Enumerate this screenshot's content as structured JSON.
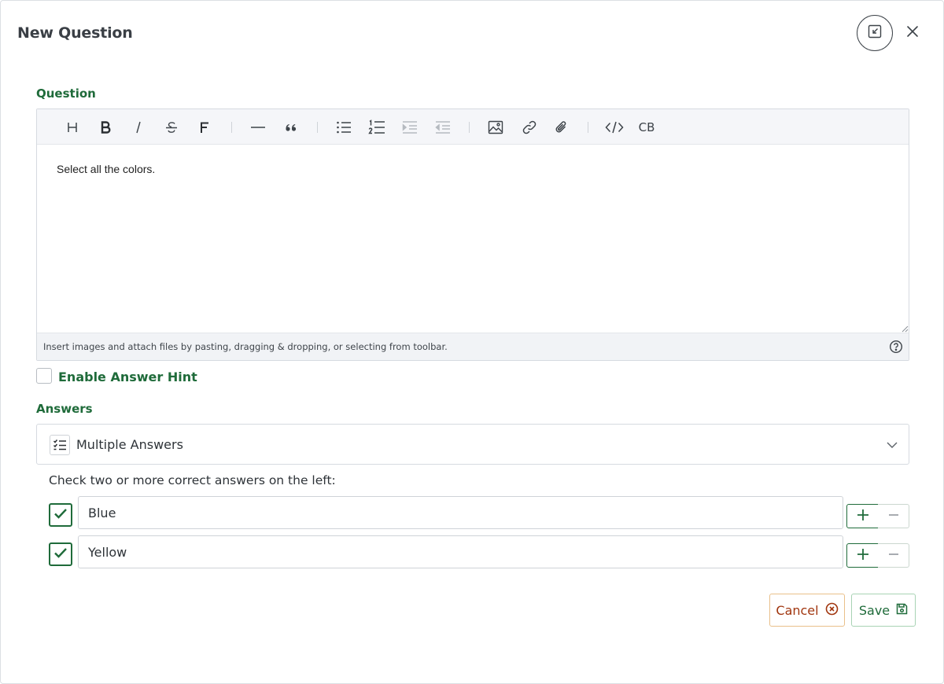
{
  "modal": {
    "title": "New Question",
    "header_icons": [
      "minimize-icon",
      "close-icon"
    ]
  },
  "question": {
    "label": "Question",
    "toolbar_icons": [
      "heading-icon",
      "bold-icon",
      "italic-icon",
      "strikethrough-icon",
      "font-icon",
      "horizontal-rule-icon",
      "quote-icon",
      "bullet-list-icon",
      "numbered-list-icon",
      "indent-icon",
      "outdent-icon",
      "image-icon",
      "link-icon",
      "attachment-icon",
      "code-icon",
      "code-block-icon"
    ],
    "code_block_label": "CB",
    "content": "Select all the colors.",
    "status_text": "Insert images and attach files by pasting, dragging & dropping, or selecting from toolbar."
  },
  "hint": {
    "label": "Enable Answer Hint",
    "checked": false
  },
  "answers": {
    "label": "Answers",
    "type_selected": "Multiple Answers",
    "instructions": "Check two or more correct answers on the left:",
    "items": [
      {
        "value": "Blue",
        "checked": true
      },
      {
        "value": "Yellow",
        "checked": true
      }
    ]
  },
  "footer": {
    "cancel_label": "Cancel",
    "save_label": "Save"
  },
  "colors": {
    "accent_green": "#1f6b3a",
    "cancel_text": "#a1360f",
    "cancel_border": "#e9c08a"
  }
}
